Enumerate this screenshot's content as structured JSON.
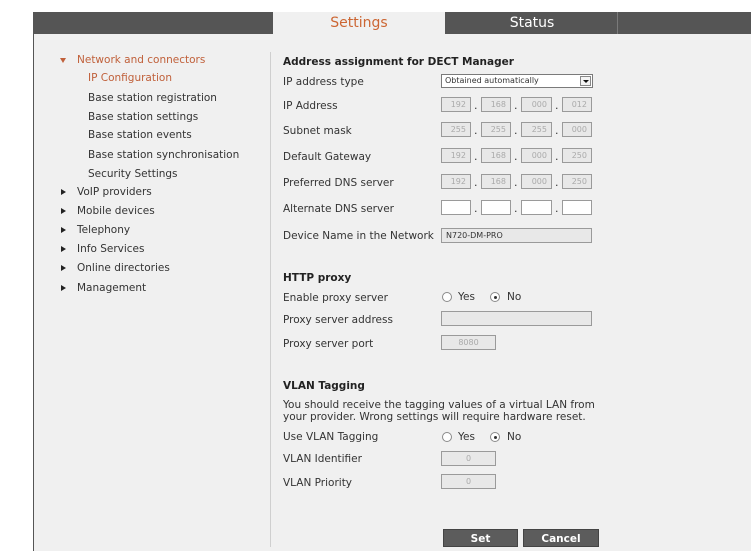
{
  "tabs": {
    "settings": "Settings",
    "status": "Status"
  },
  "nav": {
    "expanded": "Network and connectors",
    "sub": [
      "IP Configuration",
      "Base station registration",
      "Base station settings",
      "Base station events",
      "Base station synchronisation",
      "Security Settings"
    ],
    "collapsed": [
      "VoIP providers",
      "Mobile devices",
      "Telephony",
      "Info Services",
      "Online directories",
      "Management"
    ]
  },
  "address": {
    "title": "Address assignment for DECT Manager",
    "ip_type_label": "IP address type",
    "ip_type_value": "Obtained automatically",
    "ip_label": "IP Address",
    "ip": [
      "192",
      "168",
      "000",
      "012"
    ],
    "subnet_label": "Subnet mask",
    "subnet": [
      "255",
      "255",
      "255",
      "000"
    ],
    "gateway_label": "Default Gateway",
    "gateway": [
      "192",
      "168",
      "000",
      "250"
    ],
    "dns_label": "Preferred DNS server",
    "dns": [
      "192",
      "168",
      "000",
      "250"
    ],
    "alt_dns_label": "Alternate DNS server",
    "alt_dns": [
      "",
      "",
      "",
      ""
    ],
    "device_name_label": "Device Name in the Network",
    "device_name": "N720-DM-PRO"
  },
  "proxy": {
    "title": "HTTP proxy",
    "enable_label": "Enable proxy server",
    "yes": "Yes",
    "no": "No",
    "enabled": false,
    "address_label": "Proxy server address",
    "address": "",
    "port_label": "Proxy server port",
    "port": "8080"
  },
  "vlan": {
    "title": "VLAN Tagging",
    "description": "You should receive the tagging values of a virtual LAN from your provider. Wrong settings will require hardware reset.",
    "use_label": "Use VLAN Tagging",
    "yes": "Yes",
    "no": "No",
    "enabled": false,
    "id_label": "VLAN Identifier",
    "id": "0",
    "priority_label": "VLAN Priority",
    "priority": "0"
  },
  "actions": {
    "set": "Set",
    "cancel": "Cancel"
  },
  "colors": {
    "active_tab_text": "#cc6633",
    "active_nav": "#c0603a",
    "tab_bar": "#555555",
    "panel": "#f0f0f0",
    "button": "#5c5c5c"
  }
}
